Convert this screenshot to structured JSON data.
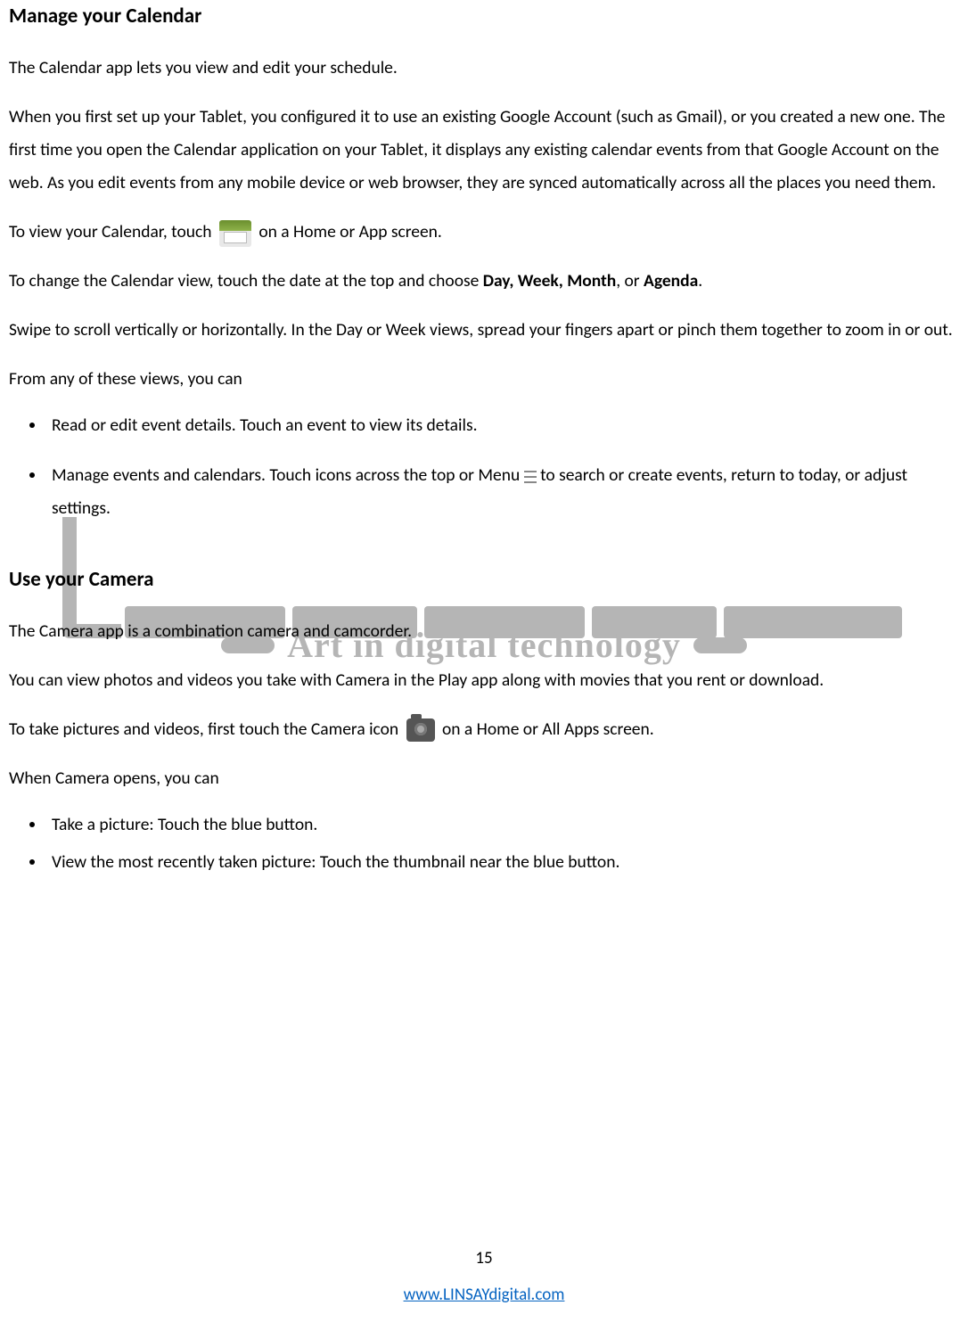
{
  "section1": {
    "heading": "Manage your Calendar",
    "p1": "The Calendar app lets you view and edit your schedule.",
    "p2": "When you first set up your Tablet, you configured it to use an existing Google Account (such as Gmail), or you created a new one. The first time you open the Calendar application on your Tablet, it displays any existing calendar events from that Google Account on the web. As you edit events from any mobile device or web browser, they are synced automatically across all the places you need them.",
    "p3a": "To view your Calendar, touch ",
    "p3b": " on a Home or App screen.",
    "p4a": "To change the Calendar view, touch the date at the top and choose ",
    "p4b_bold": "Day, Week, Month",
    "p4c": ", or ",
    "p4d_bold": "Agenda",
    "p4e": ".",
    "p5": "Swipe to scroll vertically or horizontally. In the Day or Week views, spread your fingers apart or pinch them together to zoom in or out.",
    "p6": "From any of these views, you can",
    "bullets": [
      {
        "text": "Read or edit event details. Touch an event to view its details."
      },
      {
        "pre": "Manage events and calendars. Touch icons across the top or Menu ",
        "post": " to search or create events, return to today, or adjust settings."
      }
    ]
  },
  "watermark_text": "Art in digital technology",
  "section2": {
    "heading": "Use your Camera",
    "p1": "The Camera app is a combination camera and camcorder.",
    "p2": "You can view photos and videos you take with Camera in the Play app along with movies that you rent or download.",
    "p3a": "To take pictures and videos, first touch the Camera icon ",
    "p3b": " on a Home or All Apps screen.",
    "p4": "When Camera opens, you can",
    "bullets": [
      "Take a picture: Touch the blue button.",
      "View the most recently taken picture: Touch the thumbnail near the blue button."
    ]
  },
  "footer": {
    "page_number": "15",
    "link_text": "www.LINSAYdigital.com"
  }
}
